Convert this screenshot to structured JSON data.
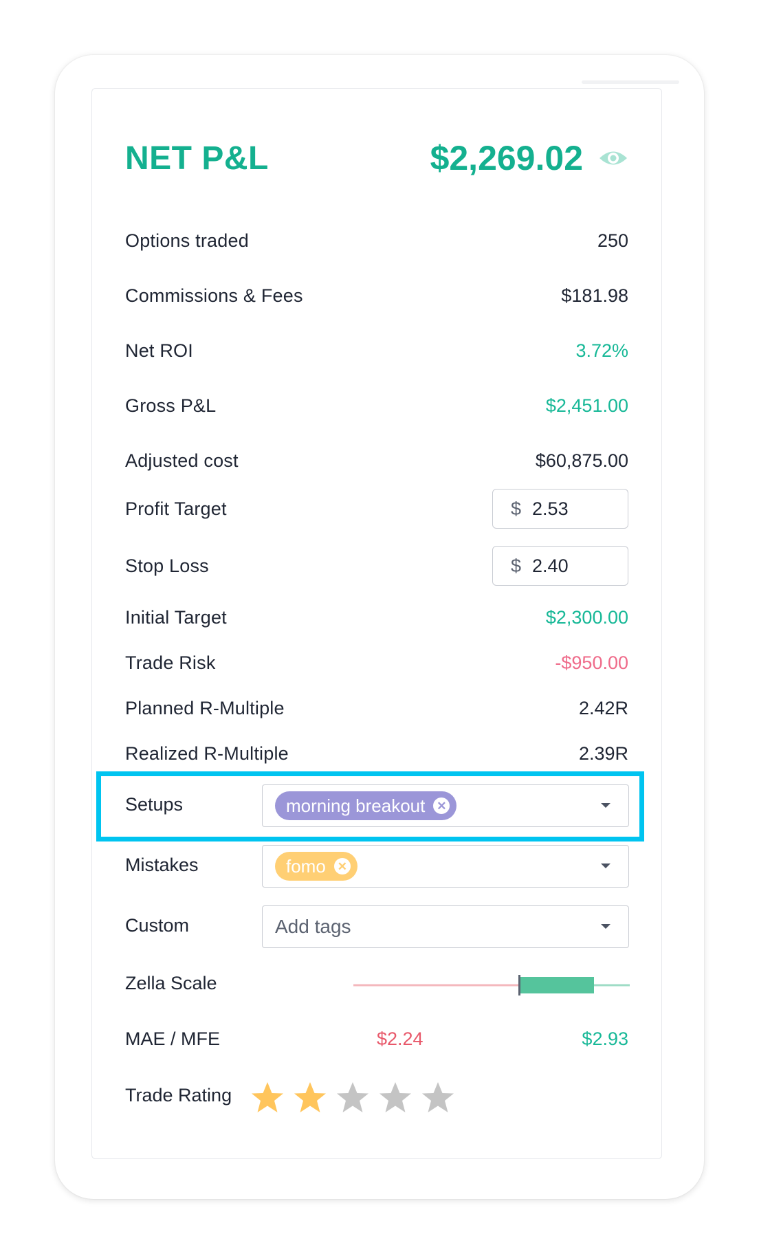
{
  "header": {
    "title": "NET P&L",
    "amount": "$2,269.02",
    "eye_icon": "eye-icon"
  },
  "stats": [
    {
      "label": "Options traded",
      "value": "250"
    },
    {
      "label": "Commissions & Fees",
      "value": "$181.98"
    },
    {
      "label": "Net ROI",
      "value": "3.72%"
    },
    {
      "label": "Gross P&L",
      "value": "$2,451.00"
    },
    {
      "label": "Adjusted cost",
      "value": "$60,875.00"
    }
  ],
  "profit_target": {
    "label": "Profit Target",
    "currency": "$",
    "value": "2.53"
  },
  "stop_loss": {
    "label": "Stop Loss",
    "currency": "$",
    "value": "2.40"
  },
  "metrics": [
    {
      "label": "Initial Target",
      "value": "$2,300.00"
    },
    {
      "label": "Trade Risk",
      "value": "-$950.00"
    },
    {
      "label": "Planned R-Multiple",
      "value": "2.42R"
    },
    {
      "label": "Realized R-Multiple",
      "value": "2.39R"
    }
  ],
  "setups": {
    "label": "Setups",
    "tag": "morning breakout"
  },
  "mistakes": {
    "label": "Mistakes",
    "tag": "fomo"
  },
  "custom": {
    "label": "Custom",
    "placeholder": "Add tags"
  },
  "zella_scale": {
    "label": "Zella Scale",
    "fill_fraction": 0.55
  },
  "mae_mfe": {
    "label": "MAE / MFE",
    "mae": "$2.24",
    "mfe": "$2.93"
  },
  "trade_rating": {
    "label": "Trade Rating",
    "stars": 2,
    "max": 5
  },
  "colors": {
    "green": "#14b08f",
    "red": "#ef6b8a",
    "purple_chip": "#9b96d8",
    "yellow_chip": "#ffcf74",
    "highlight": "#00c4f0",
    "star_on": "#ffc55c",
    "star_off": "#c4c4c4"
  }
}
